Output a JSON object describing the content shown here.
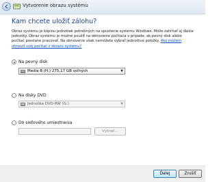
{
  "window": {
    "title": "Vytvorenie obrazu systému"
  },
  "heading": "Kam chcete uložiť zálohu?",
  "description": {
    "text": "Obraz systému je kópiou jednotiek potrebných na spustenie systému Windows. Môže zahŕňať aj ďalšie jednotky. Obraz systému je možné použiť na obnovenie počítača v prípade, ak pevný disk alebo počítač prestane pracovať. Na obnovenie však nemôžete vybrať jednotlivé položky. ",
    "link": "Ako môžem obnoviť svoj počítač z obrazu systému?"
  },
  "options": {
    "hard_disk": {
      "label": "Na pevný disk",
      "selected": true,
      "value": "Media B (H:)  275,17 GB voľných"
    },
    "dvd": {
      "label": "Na disky DVD",
      "selected": false,
      "value": "Jednotka DVD-RW (G:)"
    },
    "network": {
      "label": "Do sieťového umiestnenia",
      "selected": false,
      "value": "",
      "browse_label": "Vybrať..."
    }
  },
  "buttons": {
    "next": "Ďalej",
    "cancel": "Zrušiť"
  }
}
